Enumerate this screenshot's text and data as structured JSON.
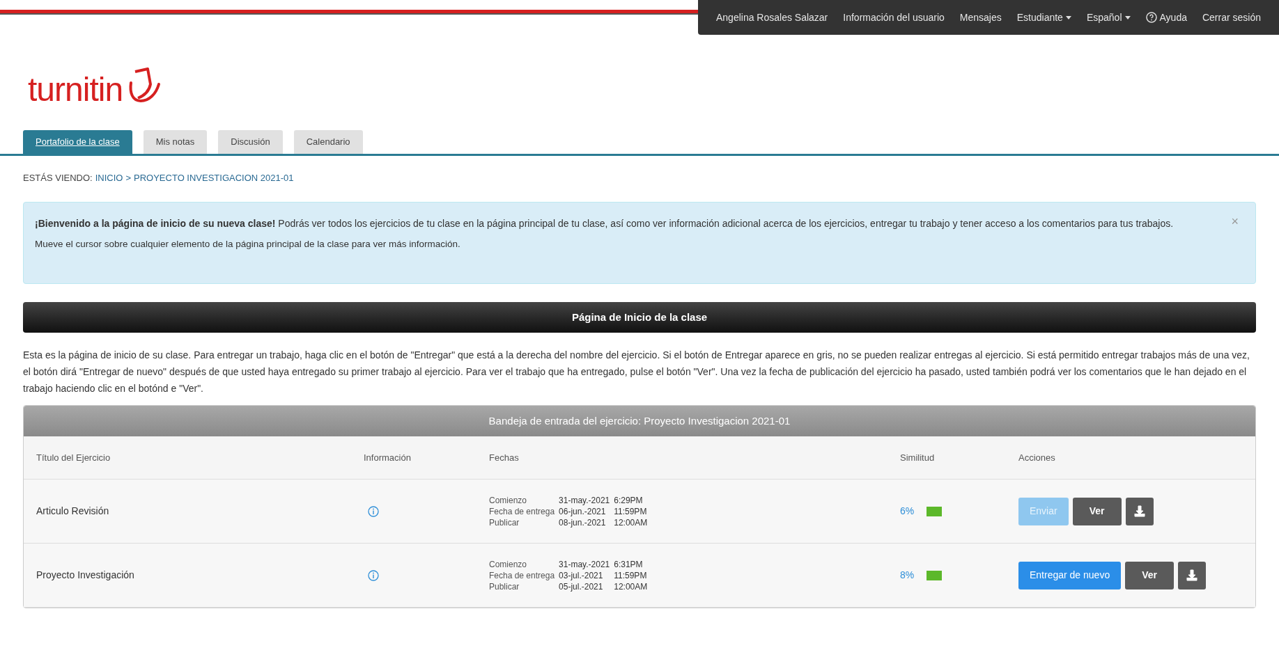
{
  "top_nav": [
    {
      "label": "Angelina Rosales Salazar",
      "kind": "link"
    },
    {
      "label": "Información del usuario",
      "kind": "link"
    },
    {
      "label": "Mensajes",
      "kind": "link"
    },
    {
      "label": "Estudiante",
      "kind": "dropdown"
    },
    {
      "label": "Español",
      "kind": "dropdown"
    },
    {
      "label": "Ayuda",
      "kind": "help"
    },
    {
      "label": "Cerrar sesión",
      "kind": "link"
    }
  ],
  "logo": {
    "text": "turnitin"
  },
  "tabs": [
    {
      "label": "Portafolio de la clase",
      "selected": true
    },
    {
      "label": "Mis notas",
      "selected": false
    },
    {
      "label": "Discusión",
      "selected": false
    },
    {
      "label": "Calendario",
      "selected": false
    }
  ],
  "breadcrumb": {
    "prefix": "ESTÁS VIENDO:",
    "items": [
      "INICIO",
      "PROYECTO INVESTIGACION 2021-01"
    ],
    "separator": ">"
  },
  "alert": {
    "text": "**¡Bienvenido a la página de inicio de su nueva clase!** Podrás ver todos los ejercicios de tu clase en la página principal de tu clase, así como ver información adicional acerca de los ejercicios, entregar tu trabajo y tener acceso a los comentarios para tus trabajos.",
    "note": "Mueve el cursor sobre cualquier elemento de la página principal de la clase para ver más información.",
    "close": "×"
  },
  "section_title": "Página de Inicio de la clase",
  "intro": "Esta es la página de inicio de su clase. Para entregar un trabajo, haga clic en el botón de \"Entregar\" que está a la derecha del nombre del ejercicio. Si el botón de Entregar aparece en gris, no se pueden realizar entregas al ejercicio. Si está permitido entregar trabajos más de una vez, el botón dirá \"Entregar de nuevo\" después de que usted haya entregado su primer trabajo al ejercicio. Para ver el trabajo que ha entregado, pulse el botón \"Ver\". Una vez la fecha de publicación del ejercicio ha pasado, usted también podrá ver los comentarios que le han dejado en el trabajo haciendo clic en el botónd e \"Ver\".",
  "table": {
    "title": "Bandeja de entrada del ejercicio: Proyecto Investigacion 2021-01",
    "columns": [
      "Título del Ejercicio",
      "Información",
      "Fechas",
      "Similitud",
      "Acciones"
    ],
    "rows": [
      {
        "title": "Articulo Revisión",
        "dates": [
          {
            "label": "Comienzo",
            "date": "31-may.-2021",
            "time": "6:29PM"
          },
          {
            "label": "Fecha de entrega",
            "date": "06-jun.-2021",
            "time": "11:59PM"
          },
          {
            "label": "Publicar",
            "date": "08-jun.-2021",
            "time": "12:00AM"
          }
        ],
        "similarity": "6%",
        "color": "#5cb82a",
        "submit": {
          "label": "Enviar",
          "disabled": true
        },
        "view": "Ver"
      },
      {
        "title": "Proyecto Investigación",
        "dates": [
          {
            "label": "Comienzo",
            "date": "31-may.-2021",
            "time": "6:31PM"
          },
          {
            "label": "Fecha de entrega",
            "date": "03-jul.-2021",
            "time": "11:59PM"
          },
          {
            "label": "Publicar",
            "date": "05-jul.-2021",
            "time": "12:00AM"
          }
        ],
        "similarity": "8%",
        "color": "#5cb82a",
        "submit": {
          "label": "Entregar de nuevo",
          "disabled": false
        },
        "view": "Ver"
      }
    ]
  }
}
